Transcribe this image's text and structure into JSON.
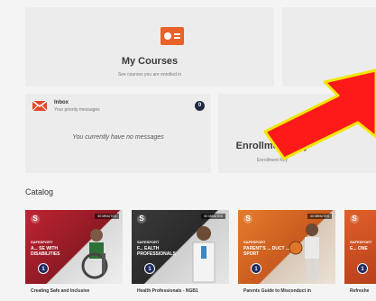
{
  "dashboard": {
    "my_courses": {
      "title": "My Courses",
      "subtitle": "See courses you are enrolled in"
    },
    "inbox": {
      "title": "Inbox",
      "subtitle": "Your priority messages",
      "count": "0",
      "empty_message": "You currently have no messages"
    },
    "enrollment": {
      "title": "Enrollment Key",
      "subtitle": "Enrollment Key"
    }
  },
  "catalog": {
    "heading": "Catalog",
    "cards": [
      {
        "tag": "60 MINUTES",
        "brand": "SAFESPORT",
        "headline": "A... SE WITH DISABILITIES",
        "badge": "1",
        "caption": "Creating Safe and Inclusive",
        "caption2": "",
        "color": "#b8202e"
      },
      {
        "tag": "60 MINUTES",
        "brand": "SAFESPORT",
        "headline": "F... EALTH PROFESSIONALS",
        "badge": "1",
        "caption": "Health Professionals - NGB1",
        "caption2": "",
        "color": "#3a3a3a"
      },
      {
        "tag": "60 MINUTES",
        "brand": "SAFESPORT",
        "headline": "PARENT'S ... DUCT ... SPORT",
        "badge": "1",
        "caption": "Parents Guide to Misconduct in",
        "caption2": "",
        "color": "#e0722a"
      },
      {
        "tag": "",
        "brand": "SAFESPORT",
        "headline": "E... ONE",
        "badge": "1",
        "caption": "Refreshe",
        "caption2": "",
        "color": "#d8532a"
      }
    ]
  },
  "annotation": {
    "arrow_color": "#ff1a1a",
    "arrow_border": "#f2e600"
  }
}
